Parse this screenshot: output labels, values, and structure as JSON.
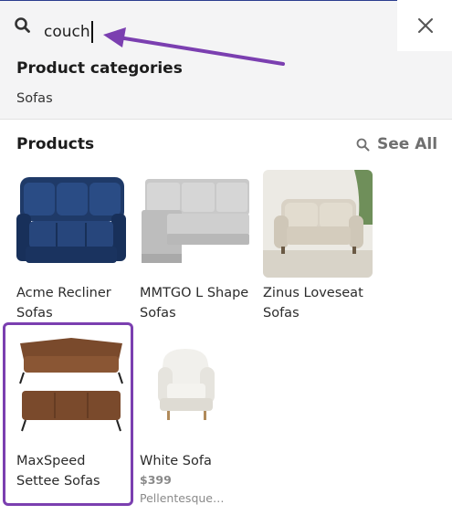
{
  "search": {
    "value": "couch"
  },
  "categories": {
    "heading": "Product categories",
    "items": [
      {
        "label": "Sofas"
      }
    ]
  },
  "products": {
    "heading": "Products",
    "see_all_label": "See All",
    "items": [
      {
        "name_line1": "Acme Recliner",
        "name_line2": "Sofas"
      },
      {
        "name_line1": "MMTGO L Shape",
        "name_line2": "Sofas"
      },
      {
        "name_line1": "Zinus Loveseat",
        "name_line2": "Sofas"
      },
      {
        "name_line1": "MaxSpeed",
        "name_line2": "Settee Sofas"
      },
      {
        "name_line1": "White Sofa",
        "price": "$399",
        "description": "Pellentesque…"
      }
    ]
  },
  "colors": {
    "highlight": "#7b3fb0",
    "recliner": "#1f3a68",
    "l_shape": "#c9c9c9",
    "loveseat": "#d9d2c5",
    "maxspeed": "#7a4a2c",
    "white_chair": "#f4f3ef"
  },
  "icons": [
    "search-icon",
    "close-icon",
    "see-all-search-icon"
  ]
}
